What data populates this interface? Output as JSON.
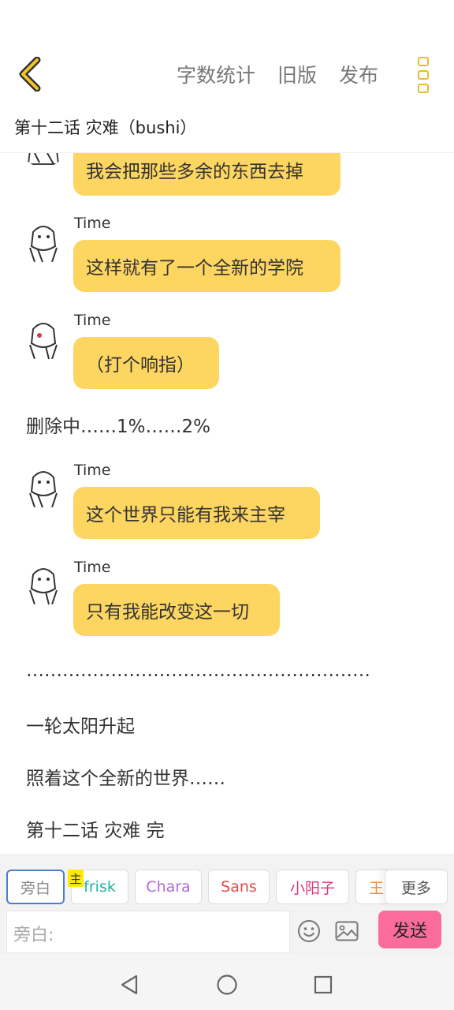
{
  "header": {
    "word_count": "字数统计",
    "old_version": "旧版",
    "publish": "发布"
  },
  "chapter_title": "第十二话 灾难（bushi）",
  "messages": [
    {
      "speaker": "",
      "text": "我会把那些多余的东西去掉"
    },
    {
      "speaker": "Time",
      "text": "这样就有了一个全新的学院"
    },
    {
      "speaker": "Time",
      "text": "（打个响指）"
    },
    {
      "narration": "删除中……1%……2%"
    },
    {
      "speaker": "Time",
      "text": "这个世界只能有我来主宰"
    },
    {
      "speaker": "Time",
      "text": "只有我能改变这一切"
    },
    {
      "narration": "…………………………………………………"
    },
    {
      "narration": "一轮太阳升起"
    },
    {
      "narration": "照着这个全新的世界……"
    },
    {
      "narration": "第十二话 灾难 完"
    }
  ],
  "roles": {
    "narration": "旁白",
    "main_tag": "主",
    "items": [
      {
        "label": "frisk",
        "color": "#20b2a0"
      },
      {
        "label": "Chara",
        "color": "#b36ad6"
      },
      {
        "label": "Sans",
        "color": "#e04848"
      },
      {
        "label": "小阳子",
        "color": "#e0357a"
      },
      {
        "label": "王",
        "color": "#f08a3a"
      }
    ],
    "more": "更多"
  },
  "input": {
    "placeholder": "旁白:",
    "send": "发送"
  },
  "colors": {
    "bubble": "#fdd662",
    "accent": "#e8bd2a",
    "send": "#fb6c9c"
  }
}
